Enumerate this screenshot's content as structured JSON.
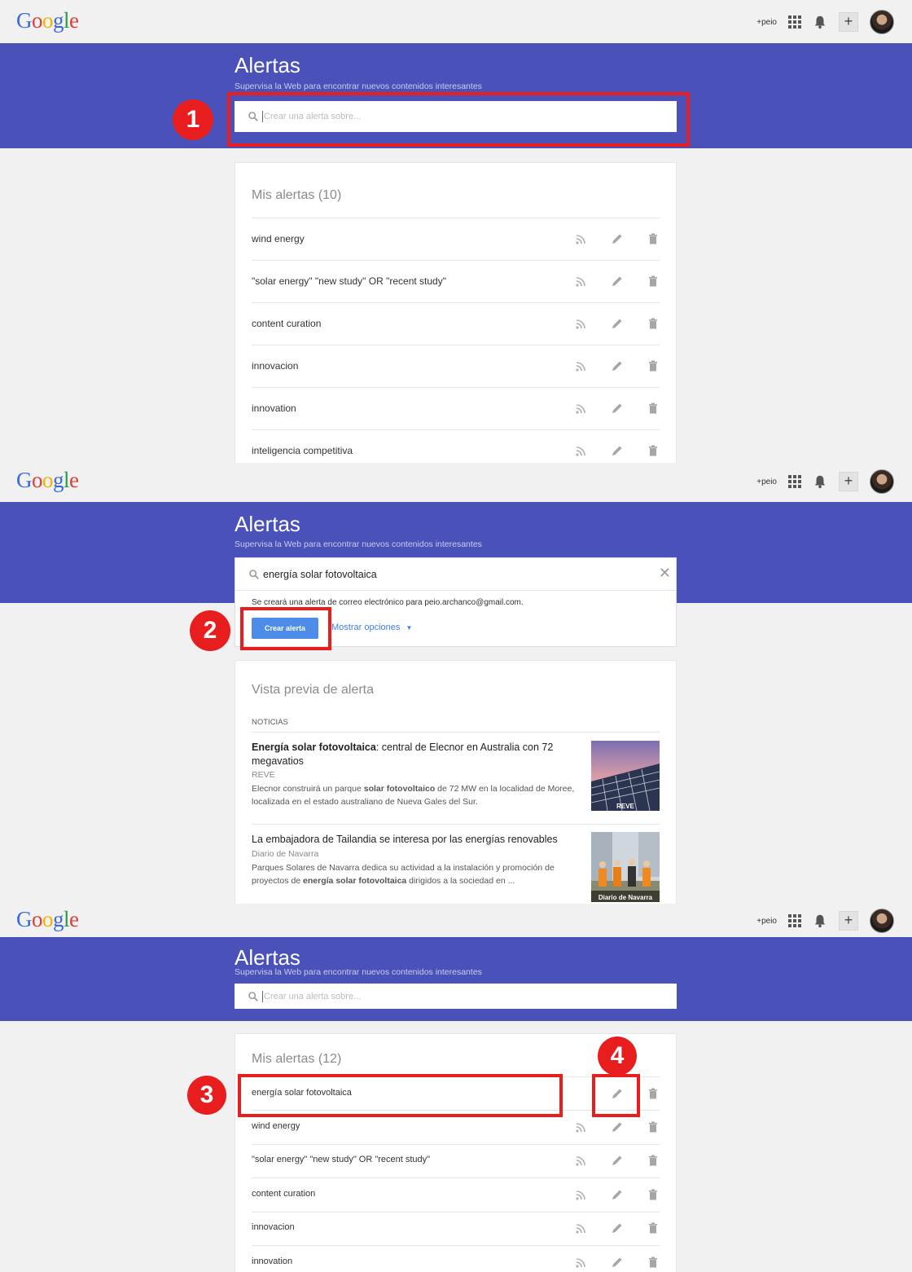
{
  "brand": {
    "logo_letters": [
      {
        "ch": "G",
        "color": "#3a6ad9"
      },
      {
        "ch": "o",
        "color": "#d9403a"
      },
      {
        "ch": "o",
        "color": "#f2b300"
      },
      {
        "ch": "g",
        "color": "#3a6ad9"
      },
      {
        "ch": "l",
        "color": "#2a9d4c"
      },
      {
        "ch": "e",
        "color": "#d9403a"
      }
    ],
    "header_blue": "#4a52b9",
    "accent_red": "#e81e1e",
    "button_blue": "#4d8ce9"
  },
  "topbar": {
    "user": "+peio",
    "apps_icon": "apps-grid-icon",
    "notifications_icon": "bell-icon",
    "add_icon": "plus-icon",
    "avatar_icon": "avatar"
  },
  "header": {
    "title": "Alertas",
    "subtitle": "Supervisa la Web para encontrar nuevos contenidos interesantes",
    "search_placeholder": "Crear una alerta sobre..."
  },
  "step1": {
    "badge": "1",
    "list_title": "Mis alertas",
    "list_count": "(10)",
    "alerts": [
      "wind energy",
      "\"solar energy\" \"new study\" OR \"recent study\"",
      "content curation",
      "innovacion",
      "innovation",
      "inteligencia competitiva"
    ]
  },
  "step2": {
    "badge": "2",
    "query": "energía solar fotovoltaica",
    "info": "Se creará una alerta de correo electrónico para peio.archanco@gmail.com.",
    "create_button": "Crear alerta",
    "options_link": "Mostrar opciones",
    "preview_title": "Vista previa de alerta",
    "section_label": "NOTICIAS",
    "news": [
      {
        "title_bold": "Energía solar fotovoltaica",
        "title_rest": ": central de Elecnor en Australia con 72 megavatios",
        "source": "REVE",
        "snippet_pre": "Elecnor construirá un parque ",
        "snippet_bold": "solar fotovoltaico",
        "snippet_post": " de 72 MW en la localidad de Moree, localizada en el estado australiano de Nueva Gales del Sur.",
        "thumb_label": "REVE"
      },
      {
        "title_bold": "",
        "title_rest": "La embajadora de Tailandia se interesa por las energías renovables",
        "source": "Diario de Navarra",
        "snippet_pre": "Parques Solares de Navarra dedica su actividad a la instalación y promoción de proyectos de ",
        "snippet_bold": "energía solar fotovoltaica",
        "snippet_post": " dirigidos a la sociedad en ...",
        "thumb_label": "Diario de Navarra"
      }
    ]
  },
  "step3": {
    "badge3": "3",
    "badge4": "4",
    "list_title": "Mis alertas",
    "list_count": "(12)",
    "alerts": [
      "energía solar fotovoltaica",
      "wind energy",
      "\"solar energy\" \"new study\" OR \"recent study\"",
      "content curation",
      "innovacion",
      "innovation"
    ]
  }
}
